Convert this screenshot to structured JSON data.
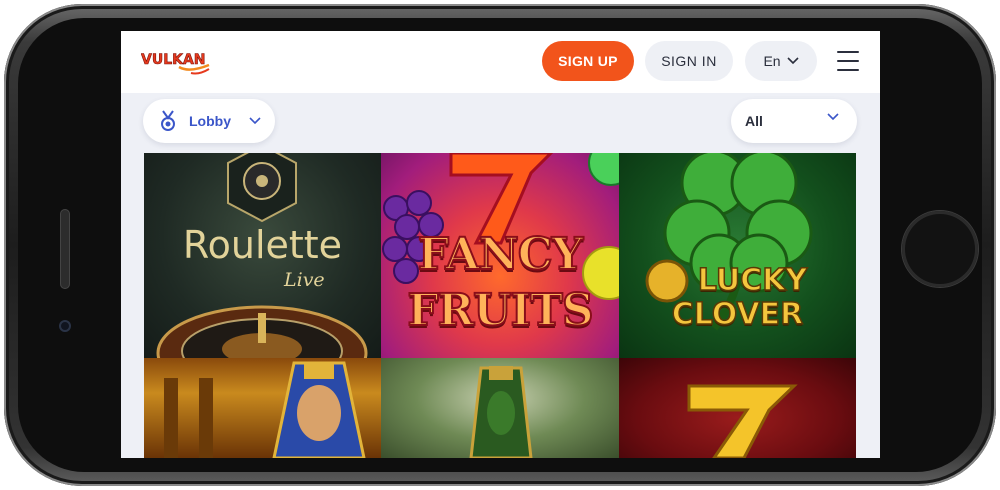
{
  "header": {
    "logo_text": "VULKAN",
    "signup_label": "SIGN UP",
    "signin_label": "SIGN IN",
    "language": "En"
  },
  "filters": {
    "category_label": "Lobby",
    "provider_label": "All"
  },
  "games": [
    {
      "title": "Roulette",
      "subtitle": "Live"
    },
    {
      "title_line1": "FANCY",
      "title_line2": "FRUITS"
    },
    {
      "title_line1": "LUCKY",
      "title_line2": "CLOVER"
    },
    {
      "title": ""
    },
    {
      "title": ""
    },
    {
      "title": ""
    }
  ],
  "colors": {
    "accent": "#f2541b",
    "link": "#3b56c9",
    "screen_bg": "#eef0f6"
  },
  "icons": [
    "medal-icon",
    "chevron-down-icon",
    "menu-icon"
  ]
}
